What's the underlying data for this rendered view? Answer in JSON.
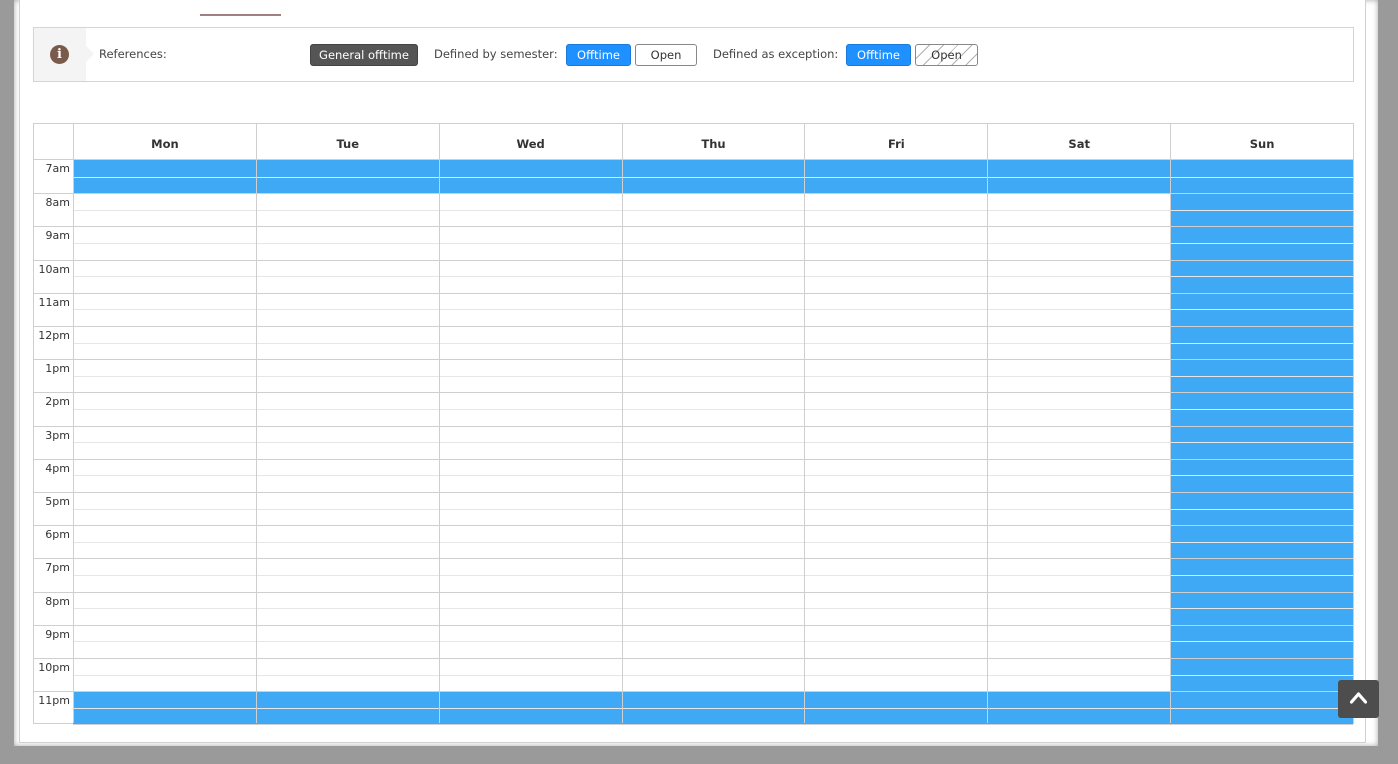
{
  "legend": {
    "title": "References:",
    "general_offtime": "General offtime",
    "semester_label": "Defined by semester:",
    "semester_offtime": "Offtime",
    "semester_open": "Open",
    "exception_label": "Defined as exception:",
    "exception_offtime": "Offtime",
    "exception_open": "Open"
  },
  "calendar": {
    "days": [
      "Mon",
      "Tue",
      "Wed",
      "Thu",
      "Fri",
      "Sat",
      "Sun"
    ],
    "hours": [
      "7am",
      "8am",
      "9am",
      "10am",
      "11am",
      "12pm",
      "1pm",
      "2pm",
      "3pm",
      "4pm",
      "5pm",
      "6pm",
      "7pm",
      "8pm",
      "9pm",
      "10pm",
      "11pm"
    ],
    "offtime_color": "#3fa9f5",
    "offtime_blocks": [
      {
        "day": "Mon",
        "from": "7am",
        "to": "8am"
      },
      {
        "day": "Tue",
        "from": "7am",
        "to": "8am"
      },
      {
        "day": "Wed",
        "from": "7am",
        "to": "8am"
      },
      {
        "day": "Thu",
        "from": "7am",
        "to": "8am"
      },
      {
        "day": "Fri",
        "from": "7am",
        "to": "8am"
      },
      {
        "day": "Sat",
        "from": "7am",
        "to": "8am"
      },
      {
        "day": "Sun",
        "from": "7am",
        "to": "12am"
      },
      {
        "day": "Mon",
        "from": "11pm",
        "to": "12am"
      },
      {
        "day": "Tue",
        "from": "11pm",
        "to": "12am"
      },
      {
        "day": "Wed",
        "from": "11pm",
        "to": "12am"
      },
      {
        "day": "Thu",
        "from": "11pm",
        "to": "12am"
      },
      {
        "day": "Fri",
        "from": "11pm",
        "to": "12am"
      },
      {
        "day": "Sat",
        "from": "11pm",
        "to": "12am"
      }
    ]
  },
  "scroll_top": {
    "icon": "chevron-up-icon"
  }
}
